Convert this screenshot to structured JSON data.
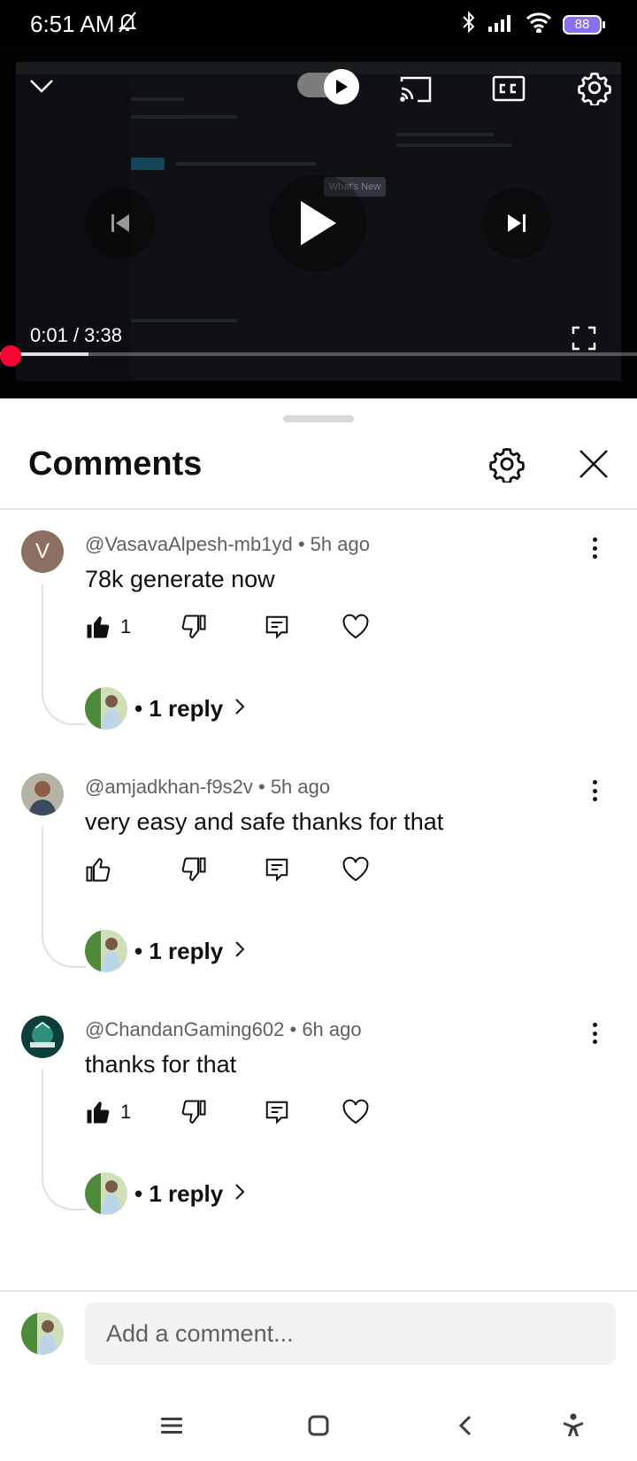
{
  "status_bar": {
    "time": "6:51 AM",
    "battery": "88"
  },
  "player": {
    "current_time": "0:01",
    "separator": " / ",
    "duration": "3:38",
    "progress_fraction": 0.0046,
    "video_content": {
      "whats_new_label": "What's New"
    }
  },
  "comments_panel": {
    "title": "Comments",
    "comments": [
      {
        "avatar_letter": "V",
        "author": "@VasavaAlpesh-mb1yd",
        "time": "5h ago",
        "text": "78k generate now",
        "likes": "1",
        "liked": true,
        "replies": "• 1 reply"
      },
      {
        "avatar_letter": "",
        "author": "@amjadkhan-f9s2v",
        "time": "5h ago",
        "text": "very easy and safe thanks for that",
        "likes": "",
        "liked": false,
        "replies": "• 1 reply"
      },
      {
        "avatar_letter": "",
        "author": "@ChandanGaming602",
        "time": "6h ago",
        "text": "thanks for that",
        "likes": "1",
        "liked": true,
        "replies": "• 1 reply"
      }
    ],
    "composer": {
      "placeholder": "Add a comment..."
    }
  },
  "icons": {
    "status": [
      "bell-off-icon",
      "bluetooth-icon",
      "signal-icon",
      "wifi-icon",
      "battery-icon"
    ],
    "player": [
      "collapse-chevron-icon",
      "autoplay-toggle",
      "cast-icon",
      "captions-icon",
      "settings-icon",
      "previous-icon",
      "play-icon",
      "next-icon",
      "fullscreen-icon"
    ],
    "comment_actions": [
      "like-icon",
      "dislike-icon",
      "reply-icon",
      "heart-icon",
      "more-vert-icon",
      "chevron-right-icon"
    ],
    "nav": [
      "menu-icon",
      "home-icon",
      "back-icon",
      "accessibility-icon"
    ]
  },
  "colors": {
    "accent_red": "#ff0033",
    "text_primary": "#0f0f0f",
    "text_secondary": "#606060",
    "composer_bg": "#f2f2f2",
    "battery": "#8a6ff0"
  }
}
